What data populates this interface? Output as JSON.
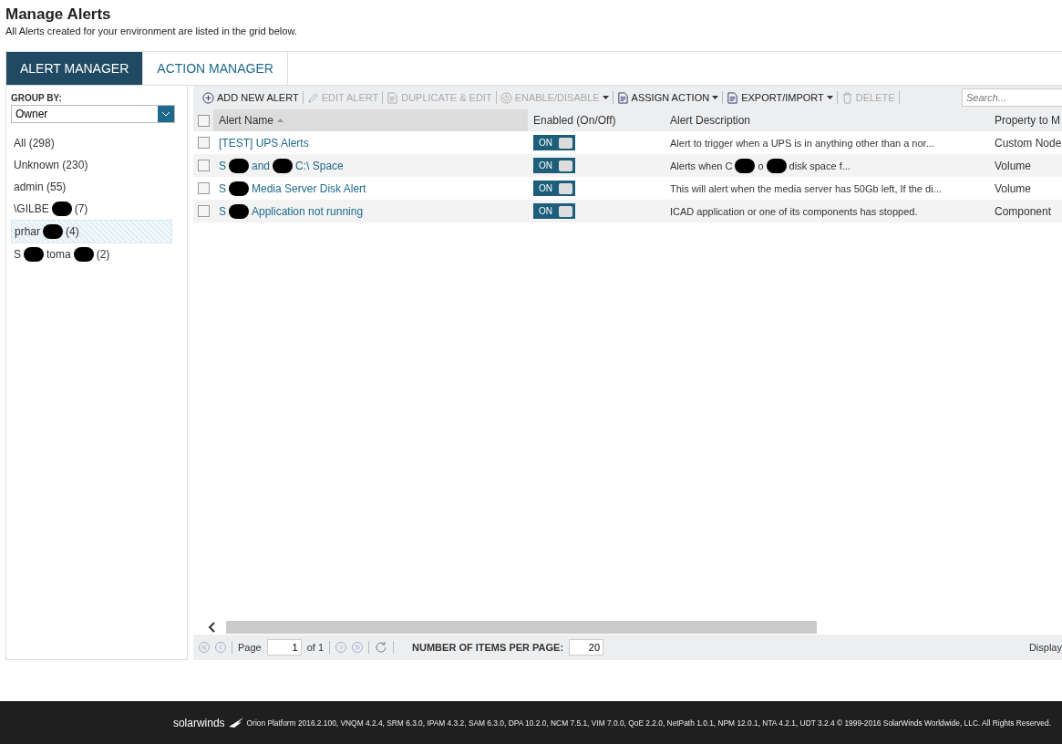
{
  "page": {
    "title": "Manage Alerts",
    "subtitle": "All Alerts created for your environment are listed in the grid below."
  },
  "tabs": [
    {
      "label": "ALERT MANAGER",
      "selected": true
    },
    {
      "label": "ACTION MANAGER",
      "selected": false
    }
  ],
  "sidebar": {
    "group_by_label": "GROUP BY:",
    "group_by_value": "Owner",
    "items": [
      {
        "parts": [
          "All (298)"
        ],
        "selected": false
      },
      {
        "parts": [
          "Unknown (230)"
        ],
        "selected": false
      },
      {
        "parts": [
          "admin (55)"
        ],
        "selected": false
      },
      {
        "parts": [
          "\\GILBE",
          "(7)"
        ],
        "selected": false
      },
      {
        "parts": [
          "prhar",
          "(4)"
        ],
        "selected": true
      },
      {
        "parts": [
          "S",
          "toma",
          "(2)"
        ],
        "selected": false
      }
    ]
  },
  "toolbar": [
    {
      "label": "ADD NEW ALERT",
      "disabled": false,
      "dropdown": false
    },
    {
      "label": "EDIT ALERT",
      "disabled": true,
      "dropdown": false
    },
    {
      "label": "DUPLICATE & EDIT",
      "disabled": true,
      "dropdown": false
    },
    {
      "label": "ENABLE/DISABLE",
      "disabled": true,
      "dropdown": true
    },
    {
      "label": "ASSIGN ACTION",
      "disabled": false,
      "dropdown": true
    },
    {
      "label": "EXPORT/IMPORT",
      "disabled": false,
      "dropdown": true
    },
    {
      "label": "DELETE",
      "disabled": true,
      "dropdown": false
    }
  ],
  "search": {
    "placeholder": "Search..."
  },
  "table": {
    "select_all_checked": false,
    "columns": [
      "Alert Name",
      "Enabled (On/Off)",
      "Alert Description",
      "Property to M"
    ],
    "rows": [
      {
        "checked": false,
        "name": [
          "[TEST] UPS Alerts"
        ],
        "enabled": true,
        "toggle_label": "ON",
        "description": [
          "Alert to trigger when a UPS is in anything other than a nor..."
        ],
        "property": "Custom Node"
      },
      {
        "checked": false,
        "name": [
          "S",
          "and",
          "C:\\ Space"
        ],
        "enabled": true,
        "toggle_label": "ON",
        "description": [
          "Alerts when C",
          "o",
          "disk space f..."
        ],
        "property": "Volume"
      },
      {
        "checked": false,
        "name": [
          "S",
          "Media Server Disk Alert"
        ],
        "enabled": true,
        "toggle_label": "ON",
        "description": [
          "This will alert when the media server has 50Gb left, If the di..."
        ],
        "property": "Volume"
      },
      {
        "checked": false,
        "name": [
          "S",
          "Application not running"
        ],
        "enabled": true,
        "toggle_label": "ON",
        "description": [
          "ICAD application or one of its components has stopped."
        ],
        "property": "Component"
      }
    ]
  },
  "pager": {
    "page_label": "Page",
    "page_value": "1",
    "of_label": "of 1",
    "per_page_label": "NUMBER OF ITEMS PER PAGE:",
    "per_page_value": "20",
    "display_label": "Display"
  },
  "footer": {
    "logo": "solarwinds",
    "text": "Orion Platform 2016.2.100, VNQM 4.2.4, SRM 6.3.0, IPAM 4.3.2, SAM 6.3.0, DPA 10.2.0, NCM 7.5.1, VIM 7.0.0, QoE 2.2.0, NetPath 1.0.1, NPM 12.0.1, NTA 4.2.1, UDT 3.2.4 © 1999-2016 SolarWinds Worldwide, LLC. All Rights Reserved."
  }
}
